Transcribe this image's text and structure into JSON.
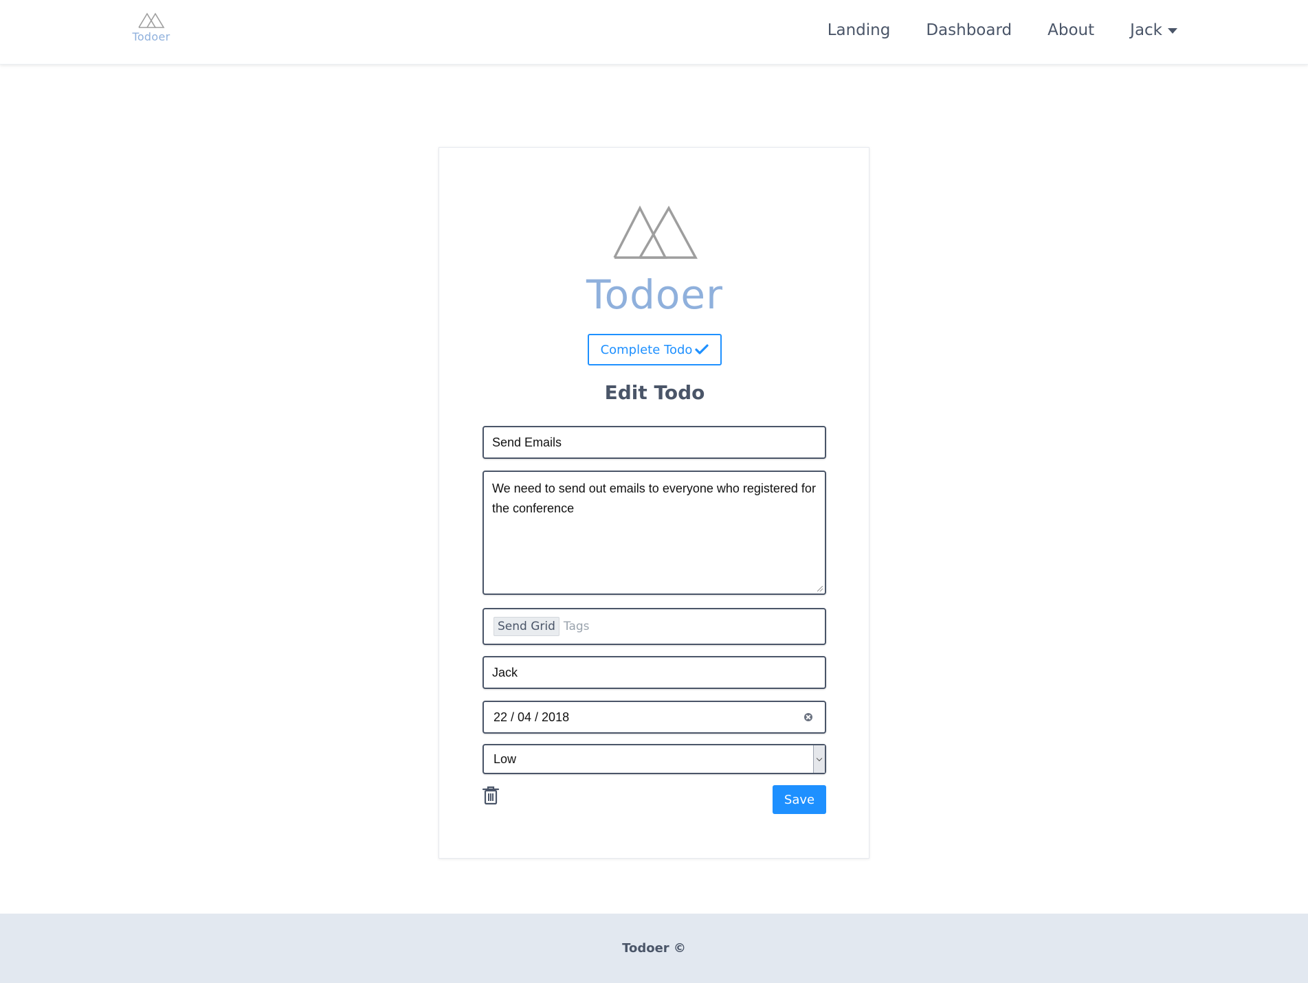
{
  "navbar": {
    "brand": "Todoer",
    "links": [
      "Landing",
      "Dashboard",
      "About"
    ],
    "user": "Jack"
  },
  "card": {
    "brand": "Todoer",
    "complete_button": "Complete Todo",
    "heading": "Edit Todo",
    "title_value": "Send Emails",
    "description_value": "We need to send out emails to everyone who registered for the conference",
    "tags": [
      "Send Grid"
    ],
    "tags_placeholder": "Tags",
    "assignee_value": "Jack",
    "date_value": "22 / 04 / 2018",
    "priority_value": "Low",
    "save_button": "Save"
  },
  "footer": {
    "text": "Todoer ©"
  },
  "colors": {
    "accent": "#1e90ff",
    "brand_text": "#8fb0dc",
    "text": "#4a5568",
    "footer_bg": "#e2e8f0"
  },
  "icons": {
    "logo": "mountains-icon",
    "complete": "check-icon",
    "user_menu": "caret-down-icon",
    "date_clear": "clear-icon",
    "priority_select": "chevron-down-icon",
    "delete": "trash-icon"
  }
}
